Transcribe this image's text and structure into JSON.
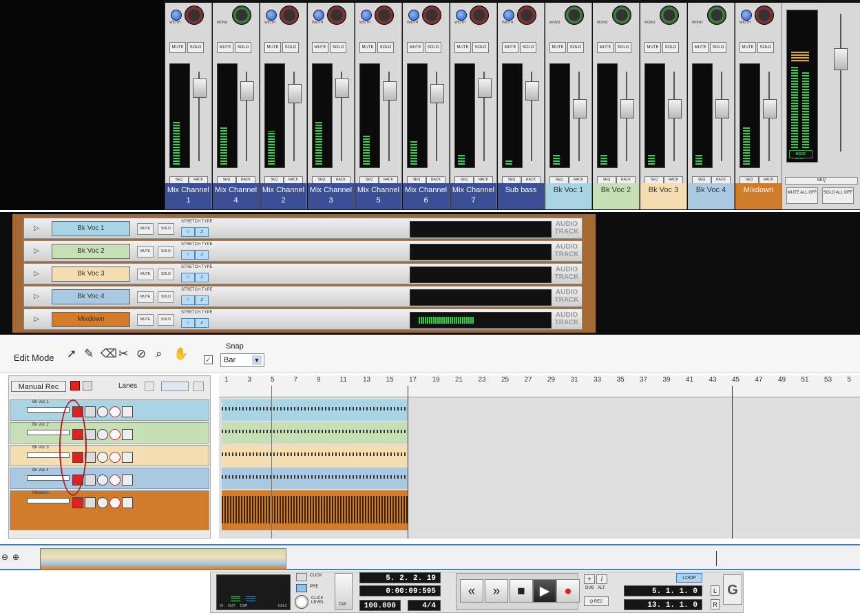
{
  "mixer": {
    "channels": [
      {
        "name": "Mix Channel 1",
        "knob": "WIDTH",
        "color": "#3c4f96",
        "fill": 0.45
      },
      {
        "name": "Mix Channel 4",
        "knob": "MONO",
        "color": "#3c4f96",
        "fill": 0.4
      },
      {
        "name": "Mix Channel 2",
        "knob": "WIDTH",
        "color": "#3c4f96",
        "fill": 0.35
      },
      {
        "name": "Mix Channel 3",
        "knob": "WIDTH",
        "color": "#3c4f96",
        "fill": 0.45
      },
      {
        "name": "Mix Channel 5",
        "knob": "WIDTH",
        "color": "#3c4f96",
        "fill": 0.3
      },
      {
        "name": "Mix Channel 6",
        "knob": "WIDTH",
        "color": "#3c4f96",
        "fill": 0.25
      },
      {
        "name": "Mix Channel 7",
        "knob": "WIDTH",
        "color": "#3c4f96",
        "fill": 0.1
      },
      {
        "name": "Sub bass",
        "knob": "WIDTH",
        "color": "#3c4f96",
        "fill": 0.05
      },
      {
        "name": "Bk Voc 1",
        "knob": "MONO",
        "color": "#a9d4e3",
        "fill": 0.1
      },
      {
        "name": "Bk Voc 2",
        "knob": "MONO",
        "color": "#c6dfb4",
        "fill": 0.1
      },
      {
        "name": "Bk Voc 3",
        "knob": "MONO",
        "color": "#f4ddb0",
        "fill": 0.1
      },
      {
        "name": "Bk Voc 4",
        "knob": "MONO",
        "color": "#a9c9e3",
        "fill": 0.1
      },
      {
        "name": "Mixdown",
        "knob": "WIDTH",
        "color": "#d07c2a",
        "fill": 0.4
      }
    ],
    "mute_label": "MUTE",
    "solo_label": "SOLO",
    "seq_label": "SEQ",
    "rack_label": "RACK",
    "master": {
      "mute_all": "MUTE ALL OFF",
      "solo_all": "SOLO ALL OFF",
      "seq": "SEQ",
      "peak": "PEAK",
      "mode": "MODE",
      "vu": "VU"
    }
  },
  "rack_tracks": [
    {
      "name": "Bk Voc 1",
      "color": "#a9d4e3",
      "level": 0
    },
    {
      "name": "Bk Voc 2",
      "color": "#c6dfb4",
      "level": 0
    },
    {
      "name": "Bk Voc 3",
      "color": "#f4ddb0",
      "level": 0
    },
    {
      "name": "Bk Voc 4",
      "color": "#a9c9e3",
      "level": 0
    },
    {
      "name": "Mixdown",
      "color": "#d07c2a",
      "level": 0.45
    }
  ],
  "rack_labels": {
    "mute": "MUTE",
    "solo": "SOLO",
    "stretch": "STRETCH TYPE",
    "type": "AUDIO TRACK"
  },
  "editbar": {
    "mode": "Edit Mode",
    "snap_label": "Snap",
    "snap_value": "Bar"
  },
  "seq_header": {
    "manual_rec": "Manual Rec",
    "lanes": "Lanes"
  },
  "seq_tracks": [
    {
      "name": "Bk Voc 1",
      "color": "#a9d4e3"
    },
    {
      "name": "Bk Voc 2",
      "color": "#c6dfb4"
    },
    {
      "name": "Bk Voc 3",
      "color": "#f4ddb0"
    },
    {
      "name": "Bk Voc 4",
      "color": "#a9c9e3"
    },
    {
      "name": "Mixdown",
      "color": "#d07c2a"
    }
  ],
  "ruler_ticks": [
    "1",
    "3",
    "5",
    "7",
    "9",
    "11",
    "13",
    "15",
    "17",
    "19",
    "21",
    "23",
    "25",
    "27",
    "29",
    "31",
    "33",
    "35",
    "37",
    "39",
    "41",
    "43",
    "45",
    "47",
    "49",
    "51",
    "53",
    "5"
  ],
  "transport": {
    "position": "5. 2. 2. 19",
    "time": "0:00:09:595",
    "tempo": "100.000",
    "signature": "4/4",
    "click": "CLICK",
    "pre": "PRE",
    "click_level": "CLICK LEVEL",
    "tap": "TAP",
    "dub": "DUB",
    "alt": "ALT",
    "qrec": "Q REC",
    "loop": "LOOP",
    "left_loc": "5. 1. 1. 0",
    "right_loc": "13. 1. 1. 0",
    "dsp": "DSP",
    "in": "IN",
    "out": "OUT",
    "calc": "CALC"
  }
}
